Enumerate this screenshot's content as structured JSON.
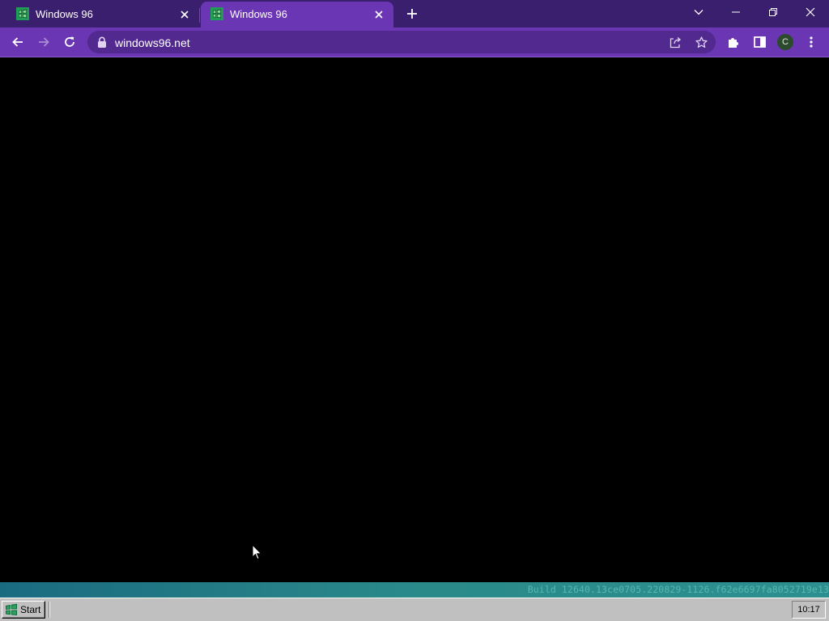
{
  "browser": {
    "tabs": [
      {
        "title": "Windows 96",
        "active": false,
        "favicon": "windows96-logo-icon"
      },
      {
        "title": "Windows 96",
        "active": true,
        "favicon": "windows96-logo-icon"
      }
    ],
    "new_tab_icon": "plus-icon",
    "window_controls": [
      "tab-search-icon",
      "minimize-icon",
      "restore-icon",
      "close-icon"
    ],
    "toolbar": {
      "back_icon": "arrow-left-icon",
      "forward_icon": "arrow-right-icon",
      "reload_icon": "reload-icon",
      "url": "windows96.net",
      "share_icon": "share-icon",
      "bookmark_icon": "star-icon",
      "extensions_icon": "puzzle-icon",
      "sidepanel_icon": "side-panel-icon",
      "profile_initial": "C",
      "menu_icon": "kebab-menu-icon"
    },
    "colors": {
      "tabstrip": "#3a1f6e",
      "toolbar": "#6b36b4",
      "omnibox": "#52298e"
    }
  },
  "w96": {
    "build_text": "Build 12640.13ce0705.220829-1126.f62e6697fa8052719e13",
    "start_label": "Start",
    "clock": "10:17",
    "colors": {
      "desktop": "#000000",
      "buildbar": "#2a8a8a",
      "taskbar": "#c0c0c0"
    }
  }
}
